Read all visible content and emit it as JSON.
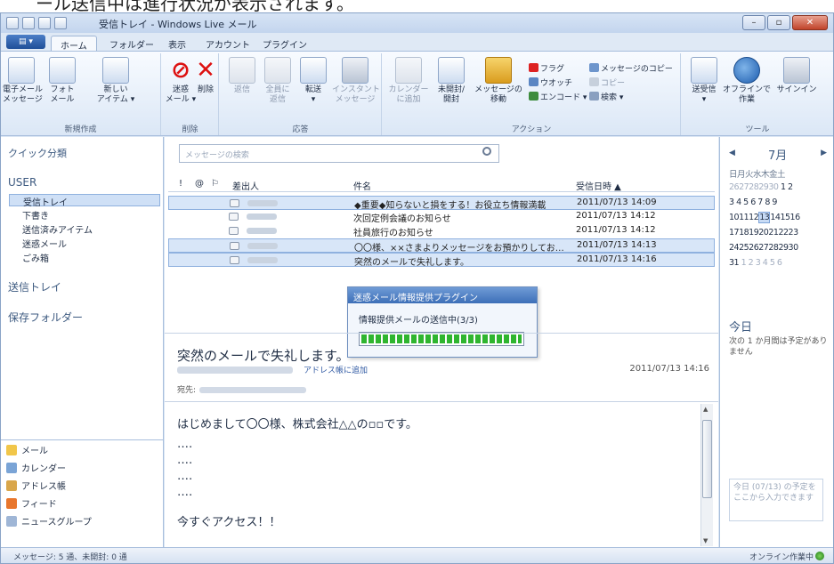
{
  "top_note": "ール送信中は進行状況が表示されます。",
  "window": {
    "title": "受信トレイ - Windows Live メール"
  },
  "tabs": [
    "ホーム",
    "フォルダー",
    "表示",
    "アカウント",
    "プラグイン"
  ],
  "ribbon": {
    "groups": [
      {
        "label": "新規作成",
        "buttons": [
          "電子メール\nメッセージ",
          "フォト\nメール",
          "新しい\nアイテム ▾"
        ]
      },
      {
        "label": "削除",
        "buttons": [
          "迷惑\nメール ▾",
          "削除"
        ]
      },
      {
        "label": "応答",
        "buttons": [
          "返信",
          "全員に\n返信",
          "転送\n▾",
          "インスタント\nメッセージ"
        ]
      },
      {
        "label": "アクション",
        "buttons": [
          "カレンダー\nに追加",
          "未開封/\n開封",
          "メッセージの\n移動"
        ],
        "small": [
          "フラグ",
          "ウオッチ",
          "エンコード ▾",
          "メッセージのコピー",
          "コピー",
          "検索 ▾"
        ]
      },
      {
        "label": "ツール",
        "buttons": [
          "送受信\n▾",
          "オフラインで\n作業",
          "サインイン"
        ]
      }
    ]
  },
  "left_pane": {
    "quick_views": "クイック分類",
    "account": "USER",
    "folders": [
      "受信トレイ",
      "下書き",
      "送信済みアイテム",
      "迷惑メール",
      "ごみ箱"
    ],
    "outbox": "送信トレイ",
    "storage": "保存フォルダー",
    "nav": [
      "メール",
      "カレンダー",
      "アドレス帳",
      "フィード",
      "ニュースグループ"
    ]
  },
  "search": {
    "placeholder": "メッセージの検索"
  },
  "list": {
    "headers": {
      "flag": "!",
      "attach": "@",
      "follow": "⚐",
      "from": "差出人",
      "subject": "件名",
      "date": "受信日時 ▲"
    },
    "rows": [
      {
        "subject": "◆重要◆知らないと損をする！お役立ち情報満載",
        "date": "2011/07/13 14:09",
        "selected": true
      },
      {
        "subject": "次回定例会議のお知らせ",
        "date": "2011/07/13 14:12",
        "selected": false
      },
      {
        "subject": "社員旅行のお知らせ",
        "date": "2011/07/13 14:12",
        "selected": false
      },
      {
        "subject": "〇〇様、××さまよりメッセージをお預かりしてお…",
        "date": "2011/07/13 14:13",
        "selected": true
      },
      {
        "subject": "突然のメールで失礼します。",
        "date": "2011/07/13 14:16",
        "selected": true
      }
    ]
  },
  "dialog": {
    "title": "迷惑メール情報提供プラグイン",
    "message": "情報提供メールの送信中(3/3)",
    "progress": 1.0
  },
  "preview": {
    "subject": "突然のメールで失礼します。",
    "add_contact": "アドレス帳に追加",
    "date": "2011/07/13 14:16",
    "to_label": "宛先:",
    "body": [
      "はじめまして〇〇様、株式会社△△の▫▫です。",
      "‥‥",
      "‥‥",
      "‥‥",
      "‥‥",
      "今すぐアクセス！！"
    ]
  },
  "calendar": {
    "month": "7月",
    "weekday_header": "日月火水木金土",
    "rows": [
      [
        "2627282930",
        "1 2"
      ],
      [
        "3 4 5 6 7 8 9"
      ],
      [
        "101112",
        "13",
        "141516"
      ],
      [
        "17181920212223"
      ],
      [
        "24252627282930"
      ],
      [
        "31 ",
        "1 2 3 4 5 6"
      ]
    ],
    "today_heading": "今日",
    "today_text": "次の 1 か月間は予定がありません",
    "quick_add": "今日 (07/13) の予定をここから入力できます"
  },
  "status": {
    "left": "メッセージ: 5 通、未開封: 0 通",
    "right": "オンライン作業中"
  }
}
